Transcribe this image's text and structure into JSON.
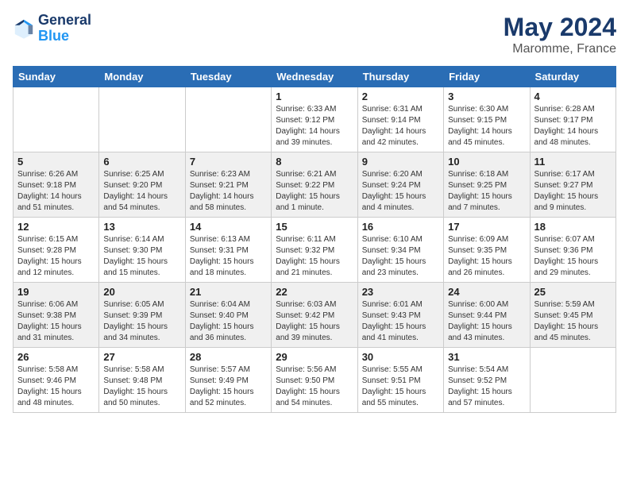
{
  "header": {
    "logo_line1": "General",
    "logo_line2": "Blue",
    "month": "May 2024",
    "location": "Maromme, France"
  },
  "days_of_week": [
    "Sunday",
    "Monday",
    "Tuesday",
    "Wednesday",
    "Thursday",
    "Friday",
    "Saturday"
  ],
  "weeks": [
    [
      {
        "day": "",
        "info": ""
      },
      {
        "day": "",
        "info": ""
      },
      {
        "day": "",
        "info": ""
      },
      {
        "day": "1",
        "info": "Sunrise: 6:33 AM\nSunset: 9:12 PM\nDaylight: 14 hours\nand 39 minutes."
      },
      {
        "day": "2",
        "info": "Sunrise: 6:31 AM\nSunset: 9:14 PM\nDaylight: 14 hours\nand 42 minutes."
      },
      {
        "day": "3",
        "info": "Sunrise: 6:30 AM\nSunset: 9:15 PM\nDaylight: 14 hours\nand 45 minutes."
      },
      {
        "day": "4",
        "info": "Sunrise: 6:28 AM\nSunset: 9:17 PM\nDaylight: 14 hours\nand 48 minutes."
      }
    ],
    [
      {
        "day": "5",
        "info": "Sunrise: 6:26 AM\nSunset: 9:18 PM\nDaylight: 14 hours\nand 51 minutes."
      },
      {
        "day": "6",
        "info": "Sunrise: 6:25 AM\nSunset: 9:20 PM\nDaylight: 14 hours\nand 54 minutes."
      },
      {
        "day": "7",
        "info": "Sunrise: 6:23 AM\nSunset: 9:21 PM\nDaylight: 14 hours\nand 58 minutes."
      },
      {
        "day": "8",
        "info": "Sunrise: 6:21 AM\nSunset: 9:22 PM\nDaylight: 15 hours\nand 1 minute."
      },
      {
        "day": "9",
        "info": "Sunrise: 6:20 AM\nSunset: 9:24 PM\nDaylight: 15 hours\nand 4 minutes."
      },
      {
        "day": "10",
        "info": "Sunrise: 6:18 AM\nSunset: 9:25 PM\nDaylight: 15 hours\nand 7 minutes."
      },
      {
        "day": "11",
        "info": "Sunrise: 6:17 AM\nSunset: 9:27 PM\nDaylight: 15 hours\nand 9 minutes."
      }
    ],
    [
      {
        "day": "12",
        "info": "Sunrise: 6:15 AM\nSunset: 9:28 PM\nDaylight: 15 hours\nand 12 minutes."
      },
      {
        "day": "13",
        "info": "Sunrise: 6:14 AM\nSunset: 9:30 PM\nDaylight: 15 hours\nand 15 minutes."
      },
      {
        "day": "14",
        "info": "Sunrise: 6:13 AM\nSunset: 9:31 PM\nDaylight: 15 hours\nand 18 minutes."
      },
      {
        "day": "15",
        "info": "Sunrise: 6:11 AM\nSunset: 9:32 PM\nDaylight: 15 hours\nand 21 minutes."
      },
      {
        "day": "16",
        "info": "Sunrise: 6:10 AM\nSunset: 9:34 PM\nDaylight: 15 hours\nand 23 minutes."
      },
      {
        "day": "17",
        "info": "Sunrise: 6:09 AM\nSunset: 9:35 PM\nDaylight: 15 hours\nand 26 minutes."
      },
      {
        "day": "18",
        "info": "Sunrise: 6:07 AM\nSunset: 9:36 PM\nDaylight: 15 hours\nand 29 minutes."
      }
    ],
    [
      {
        "day": "19",
        "info": "Sunrise: 6:06 AM\nSunset: 9:38 PM\nDaylight: 15 hours\nand 31 minutes."
      },
      {
        "day": "20",
        "info": "Sunrise: 6:05 AM\nSunset: 9:39 PM\nDaylight: 15 hours\nand 34 minutes."
      },
      {
        "day": "21",
        "info": "Sunrise: 6:04 AM\nSunset: 9:40 PM\nDaylight: 15 hours\nand 36 minutes."
      },
      {
        "day": "22",
        "info": "Sunrise: 6:03 AM\nSunset: 9:42 PM\nDaylight: 15 hours\nand 39 minutes."
      },
      {
        "day": "23",
        "info": "Sunrise: 6:01 AM\nSunset: 9:43 PM\nDaylight: 15 hours\nand 41 minutes."
      },
      {
        "day": "24",
        "info": "Sunrise: 6:00 AM\nSunset: 9:44 PM\nDaylight: 15 hours\nand 43 minutes."
      },
      {
        "day": "25",
        "info": "Sunrise: 5:59 AM\nSunset: 9:45 PM\nDaylight: 15 hours\nand 45 minutes."
      }
    ],
    [
      {
        "day": "26",
        "info": "Sunrise: 5:58 AM\nSunset: 9:46 PM\nDaylight: 15 hours\nand 48 minutes."
      },
      {
        "day": "27",
        "info": "Sunrise: 5:58 AM\nSunset: 9:48 PM\nDaylight: 15 hours\nand 50 minutes."
      },
      {
        "day": "28",
        "info": "Sunrise: 5:57 AM\nSunset: 9:49 PM\nDaylight: 15 hours\nand 52 minutes."
      },
      {
        "day": "29",
        "info": "Sunrise: 5:56 AM\nSunset: 9:50 PM\nDaylight: 15 hours\nand 54 minutes."
      },
      {
        "day": "30",
        "info": "Sunrise: 5:55 AM\nSunset: 9:51 PM\nDaylight: 15 hours\nand 55 minutes."
      },
      {
        "day": "31",
        "info": "Sunrise: 5:54 AM\nSunset: 9:52 PM\nDaylight: 15 hours\nand 57 minutes."
      },
      {
        "day": "",
        "info": ""
      }
    ]
  ]
}
